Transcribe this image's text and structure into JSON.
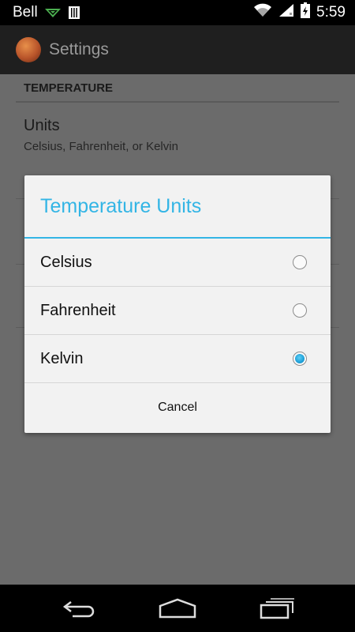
{
  "status_bar": {
    "carrier": "Bell",
    "time": "5:59"
  },
  "action_bar": {
    "title": "Settings",
    "app_icon": "mars-planet-icon"
  },
  "settings": {
    "section_header": "TEMPERATURE",
    "units_pref": {
      "title": "Units",
      "summary": "Celsius, Fahrenheit, or Kelvin"
    }
  },
  "dialog": {
    "title": "Temperature Units",
    "options": [
      {
        "label": "Celsius",
        "checked": false
      },
      {
        "label": "Fahrenheit",
        "checked": false
      },
      {
        "label": "Kelvin",
        "checked": true
      }
    ],
    "cancel_label": "Cancel"
  },
  "nav_bar": {
    "buttons": [
      "back-icon",
      "home-icon",
      "recent-apps-icon"
    ]
  },
  "colors": {
    "accent": "#33b5e5",
    "dim_background": "#6b6b6b",
    "dialog_background": "#f2f2f2"
  }
}
